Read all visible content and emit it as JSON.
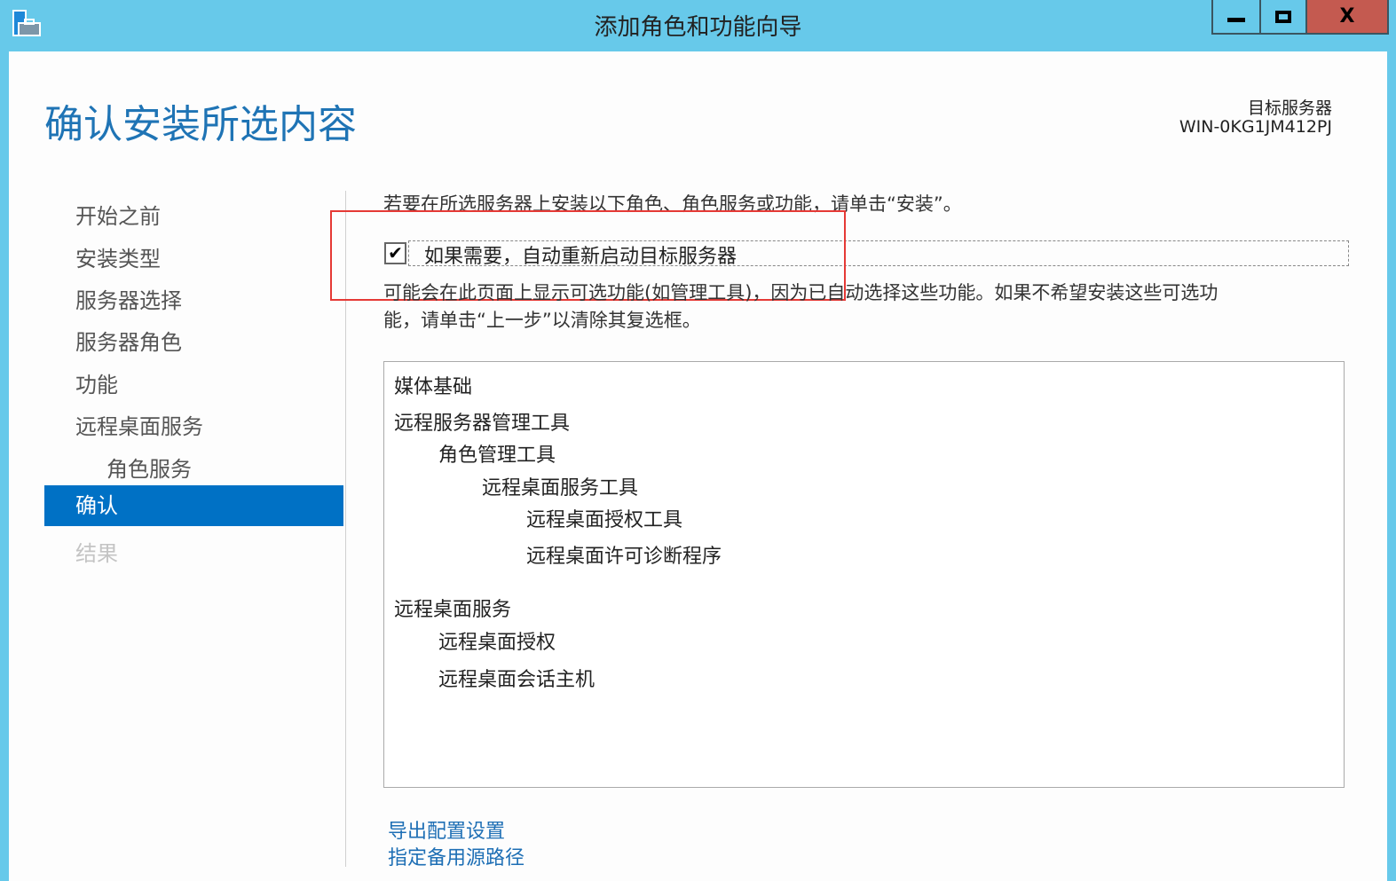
{
  "window": {
    "title": "添加角色和功能向导",
    "minimize": "▁",
    "maximize": "☐",
    "close": "X"
  },
  "header": {
    "page_title": "确认安装所选内容",
    "target_label": "目标服务器",
    "target_server": "WIN-0KG1JM412PJ"
  },
  "sidebar": {
    "items": [
      {
        "label": "开始之前"
      },
      {
        "label": "安装类型"
      },
      {
        "label": "服务器选择"
      },
      {
        "label": "服务器角色"
      },
      {
        "label": "功能"
      },
      {
        "label": "远程桌面服务"
      },
      {
        "label": "角色服务"
      },
      {
        "label": "确认"
      },
      {
        "label": "结果"
      }
    ]
  },
  "main": {
    "instruction": "若要在所选服务器上安装以下角色、角色服务或功能，请单击“安装”。",
    "restart_checkbox": {
      "label": "如果需要，自动重新启动目标服务器",
      "checked": true
    },
    "note_line1": "可能会在此页面上显示可选功能(如管理工具)，因为已自动选择这些功能。如果不希望安装这些可选功",
    "note_line2": "能，请单击“上一步”以清除其复选框。",
    "selections": [
      {
        "label": "媒体基础",
        "level": 0
      },
      {
        "label": "远程服务器管理工具",
        "level": 0
      },
      {
        "label": "角色管理工具",
        "level": 1
      },
      {
        "label": "远程桌面服务工具",
        "level": 2
      },
      {
        "label": "远程桌面授权工具",
        "level": 3
      },
      {
        "label": "远程桌面许可诊断程序",
        "level": 3
      },
      {
        "label": "远程桌面服务",
        "level": 0
      },
      {
        "label": "远程桌面授权",
        "level": 1
      },
      {
        "label": "远程桌面会话主机",
        "level": 1
      }
    ],
    "links": {
      "export": "导出配置设置",
      "alternate_source": "指定备用源路径"
    }
  }
}
